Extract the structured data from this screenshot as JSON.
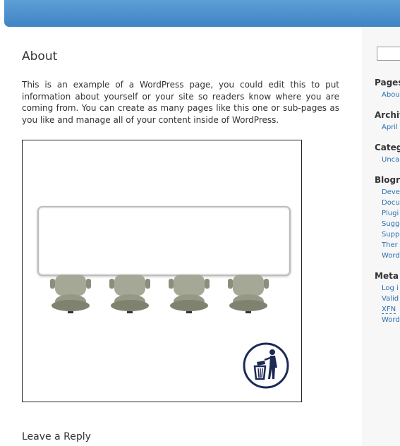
{
  "header": {
    "color": "#4a8fcd"
  },
  "post": {
    "title": "About",
    "body": "This is an example of a WordPress page, you could edit this to put information about yourself or your site so readers know where you are coming from. You can create as many pages like this one or sub-pages as you like and manage all of your content inside of WordPress.",
    "image": {
      "icons": [
        "figurine",
        "figurine",
        "figurine",
        "figurine",
        "trash-icon"
      ]
    }
  },
  "comments": {
    "title": "Leave a Reply"
  },
  "sidebar": {
    "pages": {
      "title": "Pages",
      "items": [
        "Abou"
      ]
    },
    "archives": {
      "title": "Archiv",
      "items": [
        "April"
      ]
    },
    "categories": {
      "title": "Categ",
      "items": [
        "Unca"
      ]
    },
    "blogroll": {
      "title": "Blogro",
      "items": [
        "Deve",
        "Docu",
        "Plugi",
        "Sugg",
        "Supp",
        "Ther",
        "Word"
      ]
    },
    "meta": {
      "title": "Meta",
      "items": [
        "Log i",
        "Valid",
        "XFN",
        "Word"
      ]
    }
  }
}
